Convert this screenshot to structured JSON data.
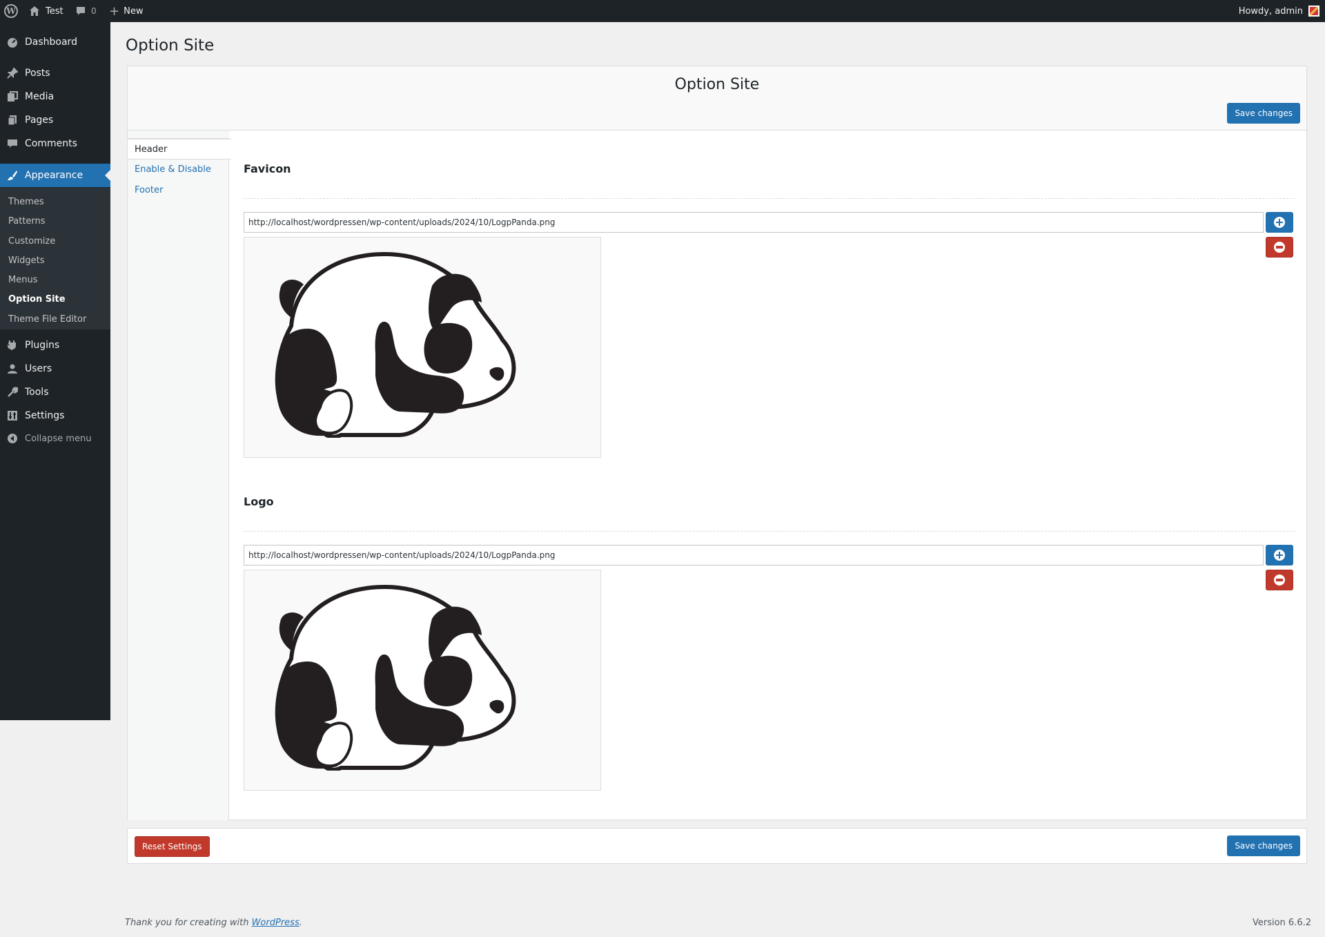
{
  "adminbar": {
    "site_name": "Test",
    "comments_count": "0",
    "new_label": "New",
    "howdy": "Howdy, admin"
  },
  "sidebar": {
    "items": [
      {
        "label": "Dashboard",
        "icon": "dashboard-icon"
      },
      {
        "label": "Posts",
        "icon": "pin-icon"
      },
      {
        "label": "Media",
        "icon": "media-icon"
      },
      {
        "label": "Pages",
        "icon": "pages-icon"
      },
      {
        "label": "Comments",
        "icon": "comment-icon"
      },
      {
        "label": "Appearance",
        "icon": "brush-icon"
      },
      {
        "label": "Plugins",
        "icon": "plugin-icon"
      },
      {
        "label": "Users",
        "icon": "user-icon"
      },
      {
        "label": "Tools",
        "icon": "wrench-icon"
      },
      {
        "label": "Settings",
        "icon": "settings-icon"
      }
    ],
    "submenu": [
      "Themes",
      "Patterns",
      "Customize",
      "Widgets",
      "Menus",
      "Option Site",
      "Theme File Editor"
    ],
    "collapse": "Collapse menu"
  },
  "page": {
    "title": "Option Site",
    "panel_title": "Option Site",
    "save_label": "Save changes",
    "reset_label": "Reset Settings"
  },
  "tabs": [
    "Header",
    "Enable & Disable",
    "Footer"
  ],
  "sections": [
    {
      "title": "Favicon",
      "url": "http://localhost/wordpressen/wp-content/uploads/2024/10/LogpPanda.png"
    },
    {
      "title": "Logo",
      "url": "http://localhost/wordpressen/wp-content/uploads/2024/10/LogpPanda.png"
    }
  ],
  "footer": {
    "thanks_prefix": "Thank you for creating with ",
    "wp_link": "WordPress",
    "suffix": ".",
    "version": "Version 6.6.2"
  },
  "colors": {
    "accent": "#2271b1",
    "danger": "#c0392b",
    "sidebar": "#1d2327"
  }
}
